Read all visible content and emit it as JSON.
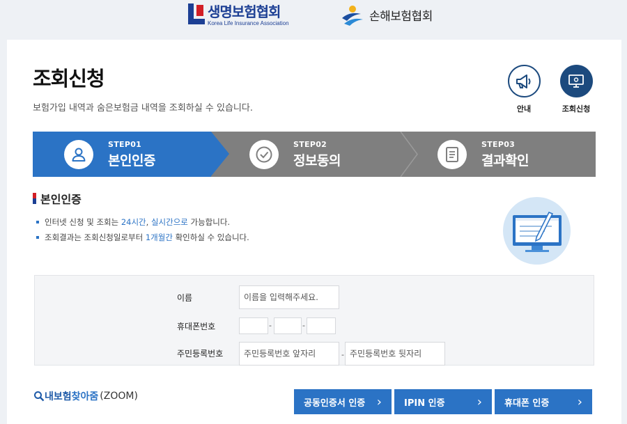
{
  "header": {
    "life_logo_name": "생명보험협회",
    "life_logo_sub": "Korea Life Insurance Association",
    "nonlife_logo_name": "손해보험협회"
  },
  "page": {
    "title": "조회신청",
    "description": "보험가입 내역과 숨은보험금 내역을 조회하실 수 있습니다."
  },
  "quick_links": [
    {
      "label": "안내",
      "icon": "megaphone-icon"
    },
    {
      "label": "조회신청",
      "icon": "monitor-icon"
    }
  ],
  "steps": [
    {
      "num": "STEP01",
      "name": "본인인증",
      "icon": "user-icon",
      "active": true
    },
    {
      "num": "STEP02",
      "name": "정보동의",
      "icon": "check-icon",
      "active": false
    },
    {
      "num": "STEP03",
      "name": "결과확인",
      "icon": "document-icon",
      "active": false
    }
  ],
  "section": {
    "title": "본인인증",
    "bullet1": {
      "pre": "인터넷 신청 및 조회는 ",
      "hl1": "24시간",
      "mid": ", ",
      "hl2": "실시간으로",
      "post": " 가능합니다."
    },
    "bullet2": {
      "pre": "조회결과는 조회신청일로부터 ",
      "hl": "1개월간",
      "post": " 확인하실 수 있습니다."
    }
  },
  "form": {
    "name_label": "이름",
    "name_placeholder": "이름을 입력해주세요.",
    "phone_label": "휴대폰번호",
    "phone_sep": "-",
    "rrn_label": "주민등록번호",
    "rrn_front_placeholder": "주민등록번호 앞자리",
    "rrn_sep": "-",
    "rrn_back_placeholder": "주민등록번호 뒷자리"
  },
  "zoom": {
    "part1": "내보험",
    "part2": "찾아줌",
    "part3": "(ZOOM)"
  },
  "auth_buttons": [
    {
      "label": "공동인증서 인증",
      "chevron": "›"
    },
    {
      "label": "IPIN 인증",
      "chevron": "›"
    },
    {
      "label": "휴대폰 인증",
      "chevron": "›"
    }
  ],
  "colors": {
    "primary": "#2b73c5",
    "navy": "#1c4a7e",
    "step_inactive": "#7f7f7f",
    "background": "#eef1f5"
  }
}
